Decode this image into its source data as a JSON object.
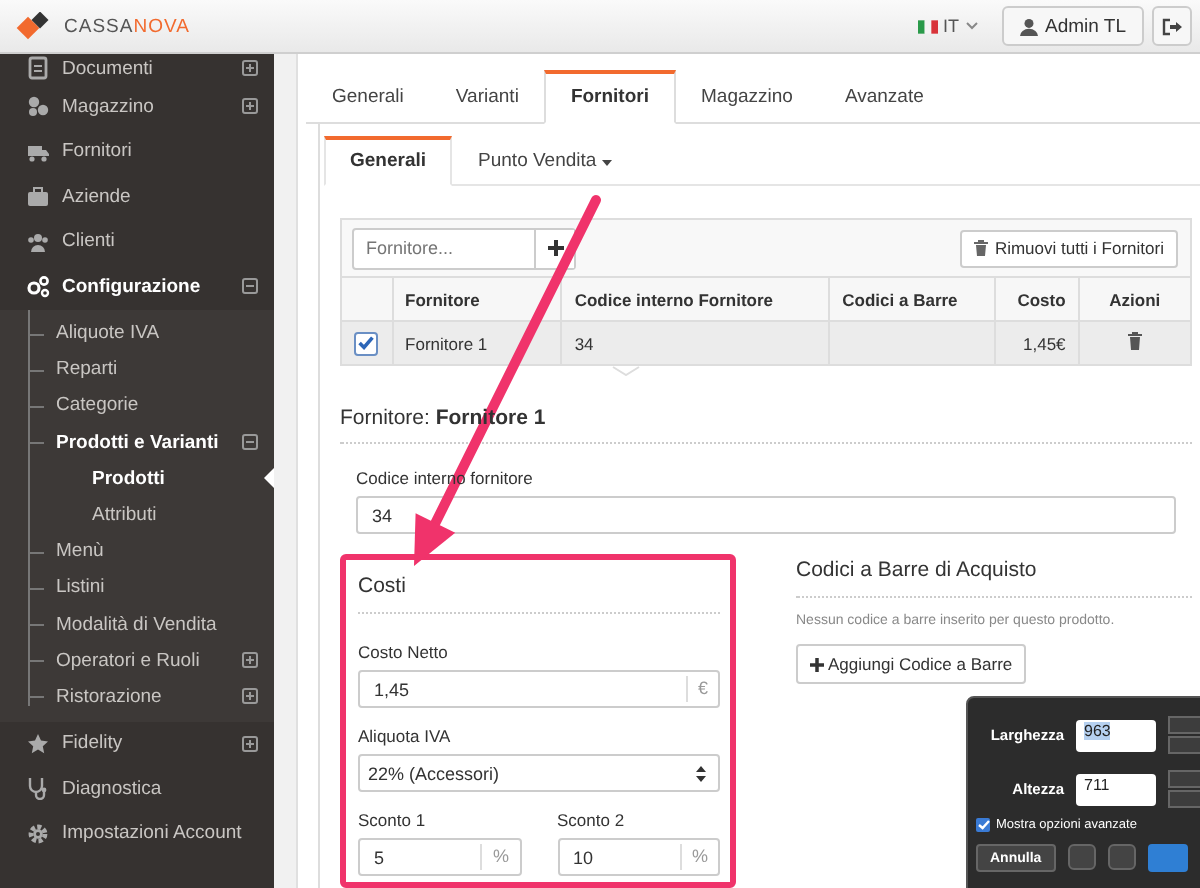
{
  "header": {
    "logo": [
      "CASSA",
      "NOVA"
    ],
    "language": "IT",
    "user_button": "Admin TL"
  },
  "sidebar": {
    "items": [
      {
        "label": "Documenti",
        "kind": "group",
        "expanded": false,
        "selected": false
      },
      {
        "label": "Magazzino",
        "kind": "group",
        "expanded": false,
        "selected": false
      },
      {
        "label": "Fornitori",
        "kind": "link",
        "selected": false
      },
      {
        "label": "Aziende",
        "kind": "link",
        "selected": false
      },
      {
        "label": "Clienti",
        "kind": "link",
        "selected": false
      },
      {
        "label": "Configurazione",
        "kind": "group",
        "expanded": true,
        "selected": false,
        "children": [
          {
            "label": "Aliquote IVA",
            "kind": "link",
            "selected": false
          },
          {
            "label": "Reparti",
            "kind": "link",
            "selected": false
          },
          {
            "label": "Categorie",
            "kind": "link",
            "selected": false
          },
          {
            "label": "Prodotti e Varianti",
            "kind": "group",
            "expanded": true,
            "selected": false,
            "children": [
              {
                "label": "Prodotti",
                "kind": "link",
                "selected": true
              },
              {
                "label": "Attributi",
                "kind": "link",
                "selected": false
              }
            ]
          },
          {
            "label": "Menù",
            "kind": "link",
            "selected": false
          },
          {
            "label": "Listini",
            "kind": "link",
            "selected": false
          },
          {
            "label": "Modalità di Vendita",
            "kind": "link",
            "selected": false
          },
          {
            "label": "Operatori e Ruoli",
            "kind": "group",
            "expanded": false,
            "selected": false
          },
          {
            "label": "Ristorazione",
            "kind": "group",
            "expanded": false,
            "selected": false
          }
        ]
      },
      {
        "label": "Fidelity",
        "kind": "group",
        "expanded": false,
        "selected": false
      },
      {
        "label": "Diagnostica",
        "kind": "link",
        "selected": false
      },
      {
        "label": "Impostazioni Account",
        "kind": "link",
        "selected": false
      }
    ]
  },
  "tabs": [
    {
      "label": "Generali",
      "selected": false
    },
    {
      "label": "Varianti",
      "selected": false
    },
    {
      "label": "Fornitori",
      "selected": true
    },
    {
      "label": "Magazzino",
      "selected": false
    },
    {
      "label": "Avanzate",
      "selected": false
    }
  ],
  "subtabs": [
    {
      "label": "Generali",
      "kind": "tab",
      "selected": true
    },
    {
      "label": "Punto Vendita",
      "kind": "dropdown",
      "selected": false
    }
  ],
  "suppliers_table": {
    "search": {
      "placeholder": "Fornitore..."
    },
    "remove_all_button": "Rimuovi tutti i Fornitori",
    "columns": [
      "Fornitore",
      "Codice interno Fornitore",
      "Codici a Barre",
      "Costo",
      "Azioni"
    ],
    "rows": [
      {
        "checked": true,
        "supplier": "Fornitore 1",
        "internal_code": "34",
        "cost": "1,45€"
      }
    ]
  },
  "supplier_detail": {
    "label": "Fornitore:",
    "name": "Fornitore 1",
    "internal_code": {
      "label": "Codice interno fornitore",
      "value": "34"
    }
  },
  "costs": {
    "title": "Costi",
    "net_cost": {
      "label": "Costo Netto",
      "value": "1,45",
      "unit": "€"
    },
    "vat": {
      "label": "Aliquota IVA",
      "value": "22% (Accessori)"
    },
    "discounts": [
      {
        "label": "Sconto 1",
        "value": "5",
        "unit": "%"
      },
      {
        "label": "Sconto 2",
        "value": "10",
        "unit": "%"
      }
    ]
  },
  "barcodes": {
    "title": "Codici a Barre di Acquisto",
    "empty_message": "Nessun codice a barre inserito per questo prodotto.",
    "add_button": "Aggiungi Codice a Barre"
  },
  "resize_dialog": {
    "fields": [
      {
        "label": "Larghezza",
        "value": "963",
        "selected": true
      },
      {
        "label": "Altezza",
        "value": "711",
        "selected": false
      }
    ],
    "advanced_option": {
      "label": "Mostra opzioni avanzate",
      "checked": true
    },
    "cancel_button": "Annulla"
  }
}
